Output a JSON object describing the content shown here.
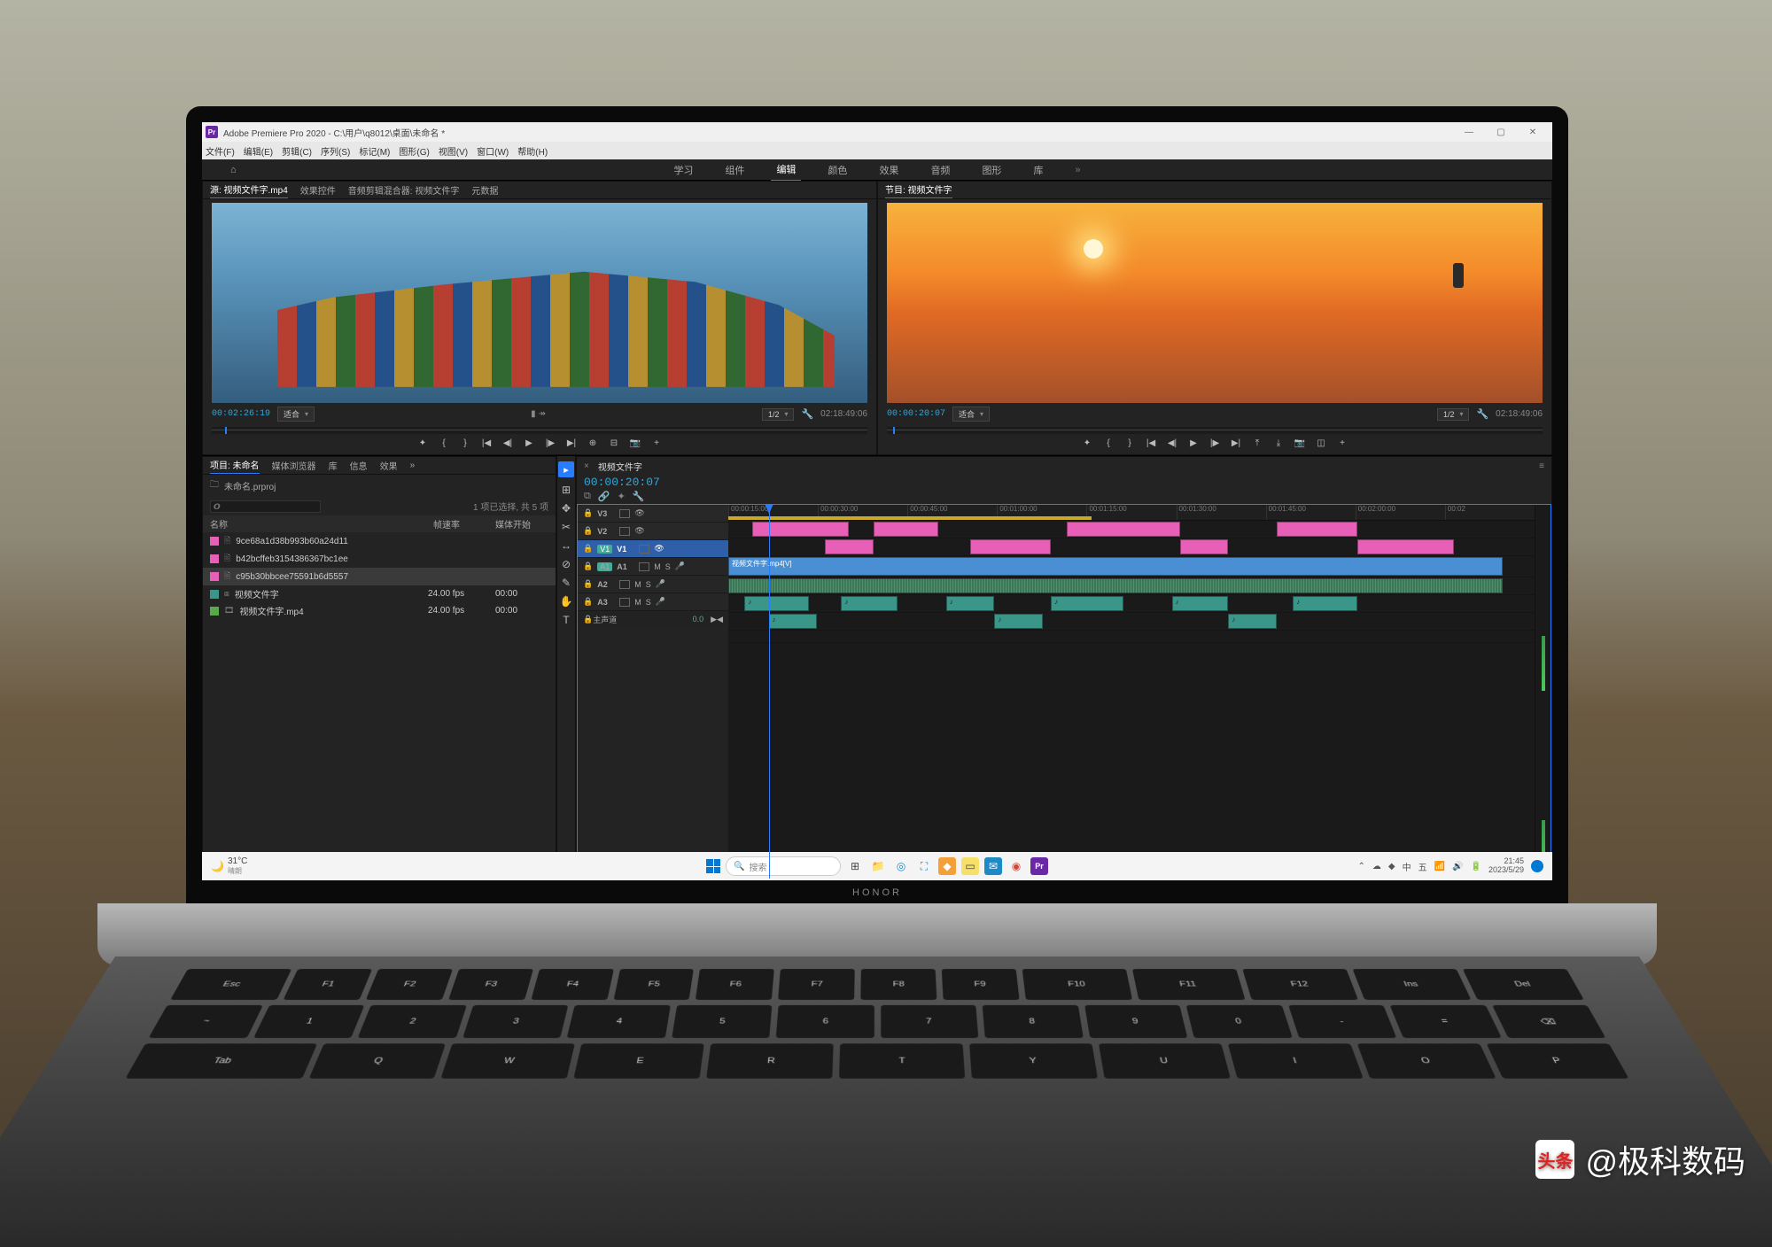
{
  "app": {
    "icon_label": "Pr",
    "title": "Adobe Premiere Pro 2020 - C:\\用户\\q8012\\桌面\\未命名 *"
  },
  "menu": [
    "文件(F)",
    "编辑(E)",
    "剪辑(C)",
    "序列(S)",
    "标记(M)",
    "图形(G)",
    "视图(V)",
    "窗口(W)",
    "帮助(H)"
  ],
  "workspaces": {
    "items": [
      "学习",
      "组件",
      "编辑",
      "颜色",
      "效果",
      "音频",
      "图形",
      "库"
    ],
    "active_index": 2
  },
  "source_panel": {
    "tabs": [
      "源: 视频文件字.mp4",
      "效果控件",
      "音频剪辑混合器: 视频文件字",
      "元数据"
    ],
    "timecode": "00:02:26:19",
    "fit_label": "适合",
    "zoom_label": "1/2",
    "duration": "02:18:49:06"
  },
  "program_panel": {
    "tab": "节目: 视频文件字",
    "timecode": "00:00:20:07",
    "fit_label": "适合",
    "zoom_label": "1/2",
    "duration": "02:18:49:06"
  },
  "project_panel": {
    "tabs": [
      "项目: 未命名",
      "媒体浏览器",
      "库",
      "信息",
      "效果"
    ],
    "filename": "未命名.prproj",
    "status": "1 项已选择, 共 5 项",
    "columns": {
      "name": "名称",
      "framerate": "帧速率",
      "media_start": "媒体开始"
    },
    "rows": [
      {
        "color": "pink",
        "name": "9ce68a1d38b993b60a24d11",
        "fr": "",
        "ms": ""
      },
      {
        "color": "pink",
        "name": "b42bcffeb3154386367bc1ee",
        "fr": "",
        "ms": ""
      },
      {
        "color": "pink",
        "name": "c95b30bbcee75591b6d5557",
        "fr": "",
        "ms": "",
        "selected": true
      },
      {
        "color": "teal",
        "name": "视频文件字",
        "fr": "24.00 fps",
        "ms": "00:00"
      },
      {
        "color": "green",
        "name": "视频文件字.mp4",
        "fr": "24.00 fps",
        "ms": "00:00"
      }
    ]
  },
  "tools": [
    "▸",
    "⊞",
    "✥",
    "✂",
    "↔",
    "⊘",
    "✎",
    "✋",
    "T"
  ],
  "timeline": {
    "sequence_name": "视频文件字",
    "timecode": "00:00:20:07",
    "master_label": "主声道",
    "master_value": "0.0",
    "time_marks": [
      "00:00:15:00",
      "00:00:30:00",
      "00:00:45:00",
      "00:01:00:00",
      "00:01:15:00",
      "00:01:30:00",
      "00:01:45:00",
      "00:02:00:00",
      "00:02"
    ],
    "tracks": {
      "video": [
        {
          "label": "V3"
        },
        {
          "label": "V2"
        },
        {
          "label": "V1",
          "targeted": true
        }
      ],
      "audio": [
        {
          "label": "A1",
          "targeted": true
        },
        {
          "label": "A2"
        },
        {
          "label": "A3"
        }
      ]
    }
  },
  "taskbar": {
    "weather_temp": "31°C",
    "weather_desc": "晴朗",
    "search_placeholder": "搜索",
    "clock_time": "21:45",
    "clock_date": "2023/5/29",
    "ime": {
      "lang": "中",
      "mode": "五"
    }
  },
  "watermark": {
    "logo": "头条",
    "text": "@极科数码"
  },
  "laptop_brand": "HONOR",
  "keyboard": {
    "row1": [
      "Esc",
      "F1",
      "F2",
      "F3",
      "F4",
      "F5",
      "F6",
      "F7",
      "F8",
      "F9",
      "F10",
      "F11",
      "F12",
      "Ins",
      "Del"
    ],
    "row2": [
      "~",
      "1",
      "2",
      "3",
      "4",
      "5",
      "6",
      "7",
      "8",
      "9",
      "0",
      "-",
      "=",
      "⌫"
    ],
    "row3": [
      "Tab",
      "Q",
      "W",
      "E",
      "R",
      "T",
      "Y",
      "U",
      "I",
      "O",
      "P"
    ]
  }
}
